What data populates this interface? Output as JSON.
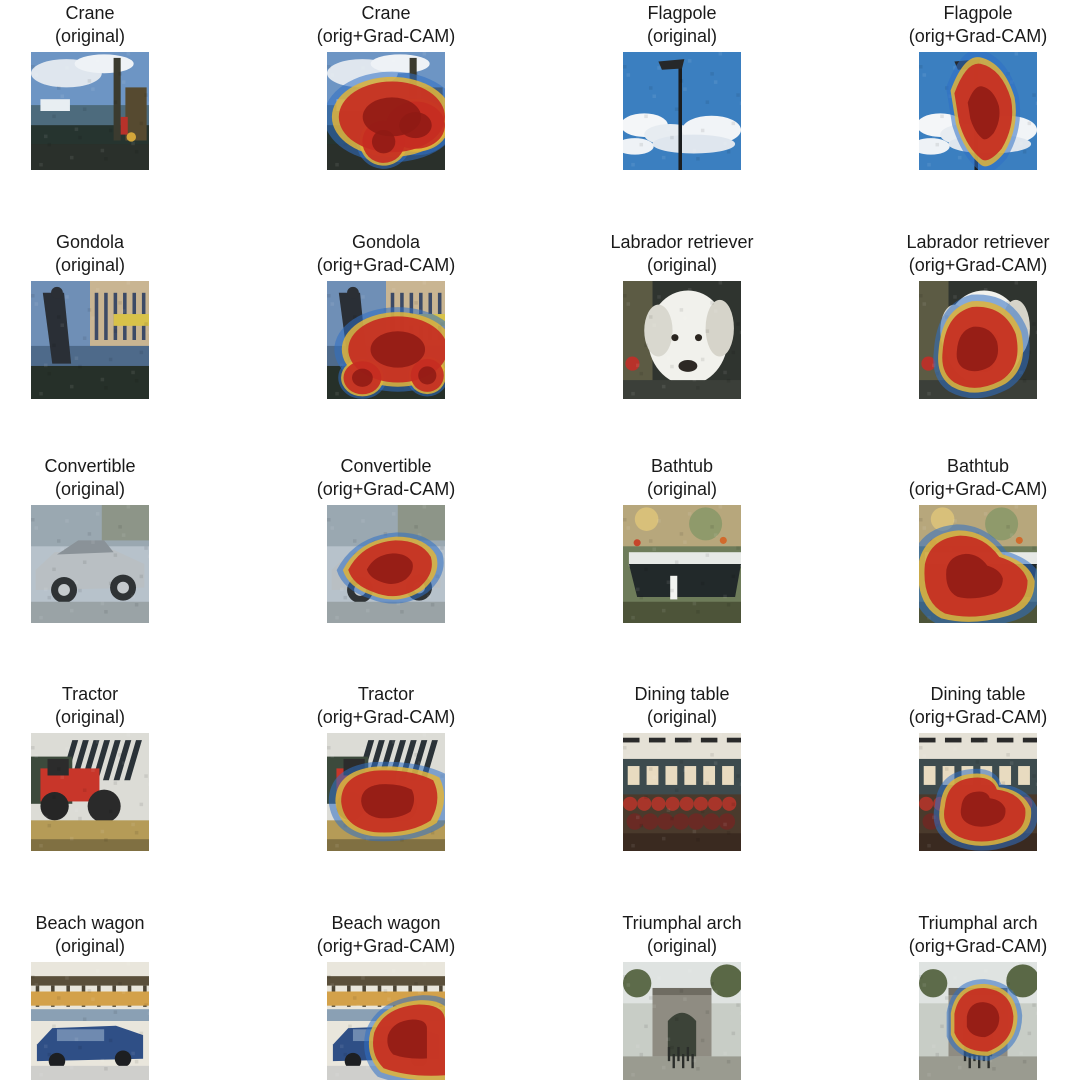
{
  "figure": {
    "columns": 4,
    "palette": {
      "sky": "#3b7fc0",
      "cloud": "#e8eef3",
      "dark": "#25302c",
      "camRed": "#c62d22",
      "camDark": "#8e1a14",
      "camYellow": "#e0b43a",
      "camBlue": "#2f6fc4"
    },
    "panels": [
      {
        "label": "Crane",
        "caption": "(original)",
        "scene": "harbor",
        "cam": null
      },
      {
        "label": "Crane",
        "caption": "(orig+Grad-CAM)",
        "scene": "harbor",
        "cam": "crane"
      },
      {
        "label": "Flagpole",
        "caption": "(original)",
        "scene": "sky",
        "cam": null
      },
      {
        "label": "Flagpole",
        "caption": "(orig+Grad-CAM)",
        "scene": "sky",
        "cam": "flagpole"
      },
      {
        "label": "Gondola",
        "caption": "(original)",
        "scene": "canal",
        "cam": null
      },
      {
        "label": "Gondola",
        "caption": "(orig+Grad-CAM)",
        "scene": "canal",
        "cam": "gondola"
      },
      {
        "label": "Labrador retriever",
        "caption": "(original)",
        "scene": "dog",
        "cam": null
      },
      {
        "label": "Labrador retriever",
        "caption": "(orig+Grad-CAM)",
        "scene": "dog",
        "cam": "labrador"
      },
      {
        "label": "Convertible",
        "caption": "(original)",
        "scene": "car",
        "cam": null
      },
      {
        "label": "Convertible",
        "caption": "(orig+Grad-CAM)",
        "scene": "car",
        "cam": "convertible"
      },
      {
        "label": "Bathtub",
        "caption": "(original)",
        "scene": "bath",
        "cam": null
      },
      {
        "label": "Bathtub",
        "caption": "(orig+Grad-CAM)",
        "scene": "bath",
        "cam": "bathtub"
      },
      {
        "label": "Tractor",
        "caption": "(original)",
        "scene": "tractor",
        "cam": null
      },
      {
        "label": "Tractor",
        "caption": "(orig+Grad-CAM)",
        "scene": "tractor",
        "cam": "tractor"
      },
      {
        "label": "Dining table",
        "caption": "(original)",
        "scene": "dining",
        "cam": null
      },
      {
        "label": "Dining table",
        "caption": "(orig+Grad-CAM)",
        "scene": "dining",
        "cam": "dining"
      },
      {
        "label": "Beach wagon",
        "caption": "(original)",
        "scene": "wagon",
        "cam": null
      },
      {
        "label": "Beach wagon",
        "caption": "(orig+Grad-CAM)",
        "scene": "wagon",
        "cam": "wagon"
      },
      {
        "label": "Triumphal arch",
        "caption": "(original)",
        "scene": "arch",
        "cam": null
      },
      {
        "label": "Triumphal arch",
        "caption": "(orig+Grad-CAM)",
        "scene": "arch",
        "cam": "arch"
      }
    ]
  }
}
